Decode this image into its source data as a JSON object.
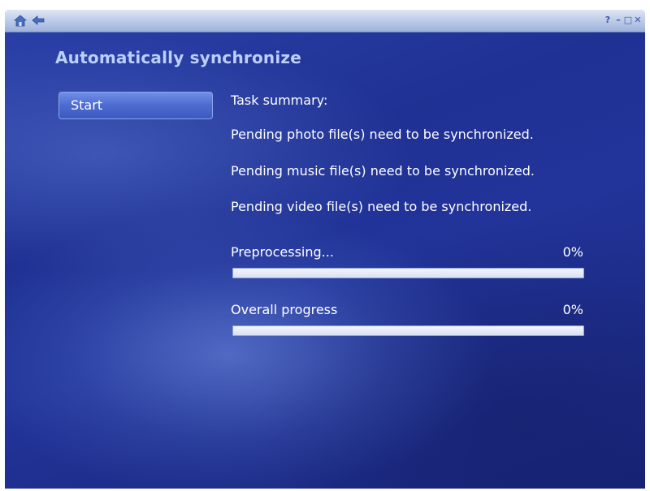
{
  "titlebar": {
    "home_icon": "home-icon",
    "back_icon": "back-arrow-icon",
    "controls": [
      "?",
      "–",
      "□",
      "✕"
    ]
  },
  "section": {
    "title": "Automatically synchronize"
  },
  "actions": {
    "start_label": "Start"
  },
  "summary": {
    "heading": "Task summary:",
    "lines": [
      "Pending photo file(s) need to be synchronized.",
      "Pending music file(s) need to be synchronized.",
      "Pending video file(s) need to be synchronized."
    ]
  },
  "progress": {
    "preprocessing": {
      "label": "Preprocessing...",
      "percent_text": "0%",
      "value": 0
    },
    "overall": {
      "label": "Overall progress",
      "percent_text": "0%",
      "value": 0
    }
  },
  "colors": {
    "background_dark": "#172478",
    "background_mid": "#2b40a8",
    "title_text": "#bcd0ff",
    "button": "#4c6bd1"
  }
}
